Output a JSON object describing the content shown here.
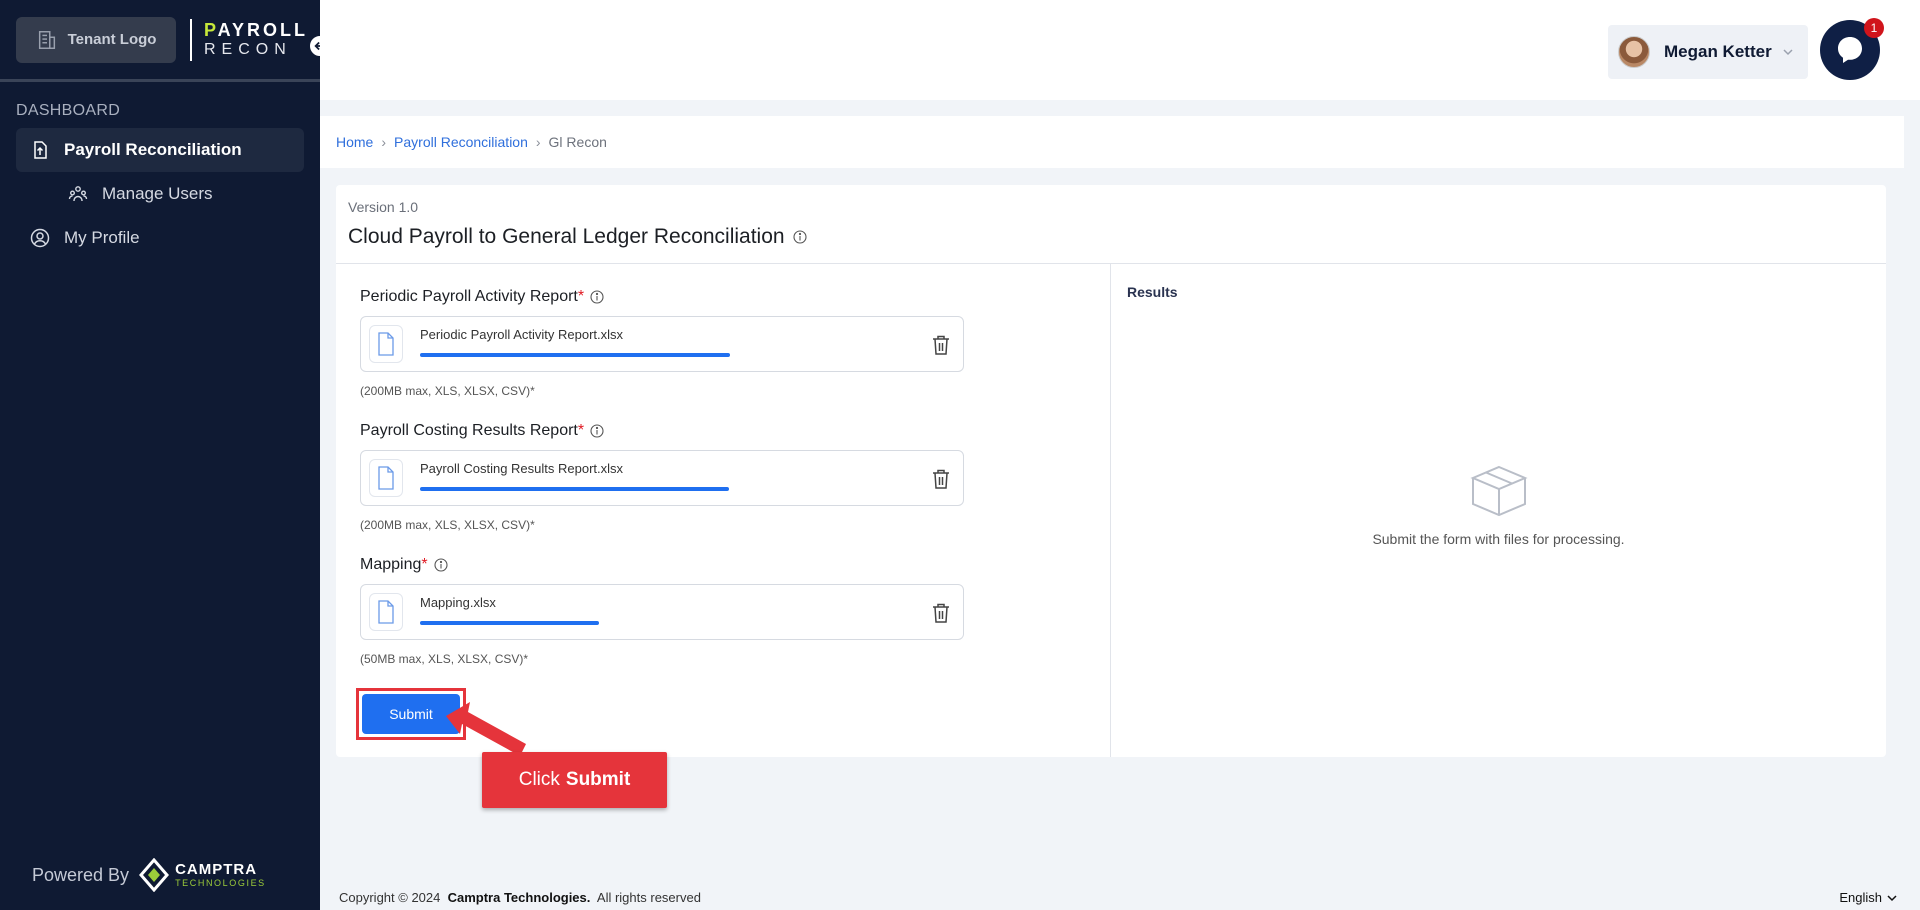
{
  "sidebar": {
    "tenant_logo": "Tenant Logo",
    "brand_line1": "AYROLL",
    "brand_line1_accent": "P",
    "brand_line2": "RECON",
    "section": "DASHBOARD",
    "items": [
      {
        "label": "Payroll Reconciliation",
        "icon": "upload-file-icon",
        "active": true
      },
      {
        "label": "Manage Users",
        "icon": "users-icon"
      },
      {
        "label": "My Profile",
        "icon": "user-circle-icon"
      }
    ],
    "powered_by": "Powered By",
    "camptra_name": "CAMPTRA",
    "camptra_sub": "TECHNOLOGIES"
  },
  "header": {
    "user_name": "Megan Ketter",
    "chat_badge": "1"
  },
  "breadcrumb": {
    "home": "Home",
    "section": "Payroll Reconciliation",
    "current": "Gl Recon"
  },
  "card": {
    "version": "Version 1.0",
    "title": "Cloud Payroll to General Ledger Reconciliation"
  },
  "fields": [
    {
      "label": "Periodic Payroll Activity Report",
      "required": "*",
      "file": "Periodic Payroll Activity Report.xlsx",
      "progress": 100,
      "hint": "(200MB max, XLS, XLSX, CSV)*"
    },
    {
      "label": "Payroll Costing Results Report",
      "required": "*",
      "file": "Payroll Costing Results Report.xlsx",
      "progress": 100,
      "hint": "(200MB max, XLS, XLSX, CSV)*"
    },
    {
      "label": "Mapping",
      "required": "*",
      "file": "Mapping.xlsx",
      "progress": 100,
      "hint": "(50MB max, XLS, XLSX, CSV)*"
    }
  ],
  "submit_label": "Submit",
  "results": {
    "title": "Results",
    "empty_text": "Submit the form with files for processing."
  },
  "callout": {
    "prefix": "Click",
    "target": "Submit"
  },
  "footer": {
    "copyright": "Copyright © 2024",
    "company": "Camptra Technologies.",
    "rights": "All rights reserved",
    "language": "English"
  },
  "colors": {
    "sidebar_bg": "#0f1a33",
    "accent_blue": "#1f6ff0",
    "callout_red": "#e5343b",
    "brand_green": "#c6e83a"
  }
}
